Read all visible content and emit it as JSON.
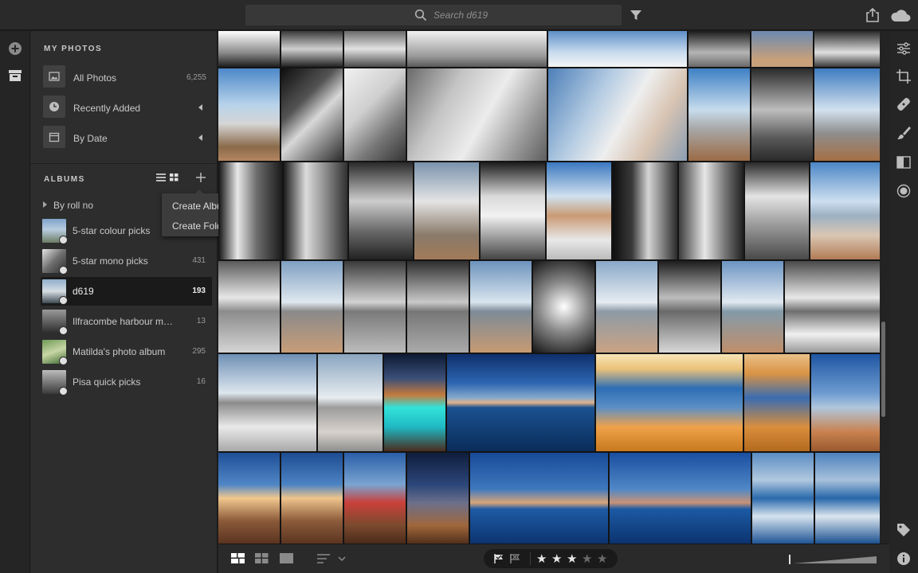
{
  "colors": {
    "accent": "#ffffff",
    "selected_bg": "#1a1a1a",
    "panel": "#2d2d2d",
    "grid_bg": "#141414"
  },
  "search": {
    "placeholder": "Search d619",
    "icon": "search-icon"
  },
  "toolbar": {
    "filter_icon": "filter-icon",
    "share_icon": "share-icon",
    "cloud_icon": "cloud-sync-icon"
  },
  "left_rail": {
    "icons": [
      "add-icon",
      "library-icon"
    ]
  },
  "my_photos": {
    "title": "MY PHOTOS",
    "items": [
      {
        "label": "All Photos",
        "count": "6,255",
        "icon": "photo-icon"
      },
      {
        "label": "Recently Added",
        "count": "",
        "icon": "clock-icon",
        "expandable": true
      },
      {
        "label": "By Date",
        "count": "",
        "icon": "calendar-icon",
        "expandable": true
      }
    ]
  },
  "albums": {
    "title": "ALBUMS",
    "tool_icons": [
      "list-view-icon",
      "grid-view-icon",
      "add-icon"
    ],
    "group": "By roll no",
    "items": [
      {
        "label": "5-star colour picks",
        "count": "",
        "selected": false
      },
      {
        "label": "5-star mono picks",
        "count": "431",
        "selected": false
      },
      {
        "label": "d619",
        "count": "193",
        "selected": true
      },
      {
        "label": "Ilfracombe harbour m…",
        "count": "13",
        "selected": false
      },
      {
        "label": "Matilda's photo album",
        "count": "295",
        "selected": false
      },
      {
        "label": "Pisa quick picks",
        "count": "16",
        "selected": false
      }
    ]
  },
  "popup_menu": {
    "items": [
      "Create Album",
      "Create Folder"
    ]
  },
  "right_rail": {
    "icons": [
      "edit-sliders-icon",
      "crop-icon",
      "healing-icon",
      "brush-icon",
      "linear-gradient-icon",
      "radial-gradient-icon",
      "tag-icon",
      "info-icon"
    ]
  },
  "bottom_bar": {
    "view_icons": [
      "photo-grid-icon",
      "square-grid-icon",
      "detail-view-icon",
      "sort-icon"
    ],
    "flag_icons": [
      "pick-flag-icon",
      "reject-flag-icon"
    ],
    "rating": {
      "value": 3,
      "max": 5
    }
  }
}
